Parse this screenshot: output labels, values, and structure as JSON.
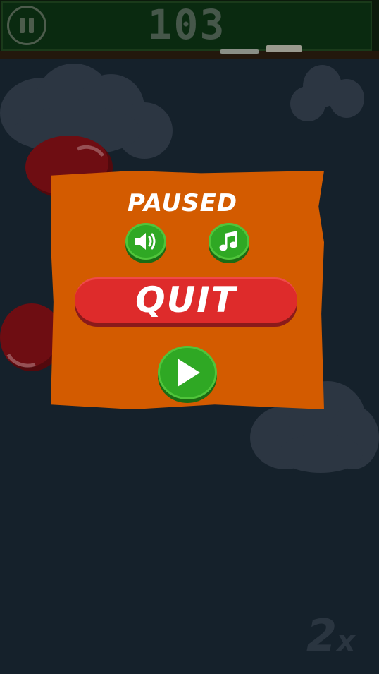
{
  "hud": {
    "score": "103",
    "multiplier": "2",
    "multiplier_suffix": "x"
  },
  "pause_menu": {
    "title": "PAUSED",
    "quit_label": "QUIT"
  },
  "icons": {
    "pause": "pause-icon",
    "sound": "speaker-icon",
    "music": "music-note-icon",
    "play": "play-icon"
  },
  "colors": {
    "panel": "#d35b00",
    "quit_button": "#de2b2b",
    "round_button": "#2fa824",
    "background": "#15212b"
  }
}
